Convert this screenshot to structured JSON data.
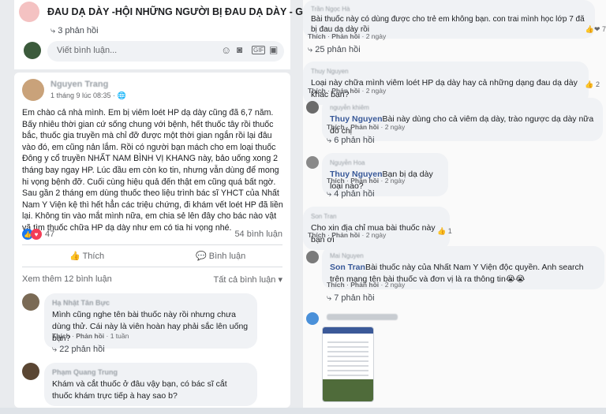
{
  "group": {
    "title": "ĐAU DẠ DÀY -HỘI NHỮNG NGƯỜI BỊ ĐAU DẠ DÀY - GIÚ..."
  },
  "left": {
    "top_reply": "3 phản hồi",
    "comment_placeholder": "Viết bình luận...",
    "post": {
      "author": "Nguyen Trang",
      "time": "1 tháng 9 lúc 08:35 ·",
      "body": "Em chào cả nhà mình. Em bị viêm loét HP dạ dày cũng đã 6,7 năm. Bấy nhiêu thời gian cứ sống chung với bệnh, hết thuốc tây rồi thuốc bắc, thuốc gia truyền mà chỉ đỡ được một thời gian ngắn rồi lại đâu vào đó, em cũng nản lắm. Rồi có người bạn mách cho em loại thuốc Đông y cổ truyền NHẤT NAM BÌNH VỊ KHANG này, bảo uống xong 2 tháng bay ngay HP. Lúc đầu em còn ko tin, nhưng vẫn dùng để mong hi vọng bệnh đỡ. Cuối cùng hiệu quả đến thật em cũng quá bất ngờ. Sau gần 2 tháng em dùng thuốc theo liệu trình bác sĩ YHCT của Nhất Nam Y Viện kệ thì hết hẳn các triệu chứng, đi khám vết loét HP đã liền lại. Không tin vào mắt mình nữa, em chia sẻ lên đây cho bác nào vật vã tìm thuốc chữa HP dạ dày như em có tia hi vọng nhé.",
      "reactions": "47",
      "comments_count": "54 bình luận",
      "like": "Thích",
      "comment": "Bình luận",
      "see_more": "Xem thêm 12 bình luận",
      "filter": "Tất cả bình luận"
    },
    "comments": [
      {
        "author": "Hạ Nhật Tân Bực",
        "text": "Mình cũng nghe tên bài thuốc này rồi nhưng chưa dùng thử. Cái này là viên hoàn hay phải sắc lên uống bạn?",
        "meta_like": "Thích",
        "meta_reply": "Phản hồi",
        "meta_time": "1 tuần",
        "replies": "22 phản hồi"
      },
      {
        "author": "Phạm Quang Trung",
        "text": "Khám và cắt thuốc ở đâu vậy bạn, có bác sĩ cắt thuốc khám trực tiếp à hay sao b?"
      }
    ]
  },
  "right": {
    "items": [
      {
        "author": "Trần Ngọc Hà",
        "text": "Bài thuốc này có dùng được cho trẻ em không bạn. con trai mình học lớp 7 đã bị đau dạ dày rồi",
        "like": "Thích",
        "reply": "Phản hồi",
        "time": "2 ngày",
        "replies": "25 phản hồi",
        "react": "7"
      },
      {
        "author": "Thuy Nguyen",
        "text": "Loại này chữa mình viêm loét HP dạ dày hay cả những dạng đau dạ dày khác bạn?",
        "like": "Thích",
        "reply": "Phản hồi",
        "time": "2 ngày",
        "react": "2"
      },
      {
        "author": "nguyễn khiêm",
        "tag": "Thuy Nguyen",
        "text": "Bài này dùng cho cả viêm dạ dày, trào ngược dạ dày nữa đó chị",
        "like": "Thích",
        "reply": "Phản hồi",
        "time": "2 ngày",
        "replies": "6 phản hồi"
      },
      {
        "author": "Nguyễn Hoa",
        "tag": "Thuy Nguyen",
        "text": "Bạn bị dạ dày loại nào?",
        "like": "Thích",
        "reply": "Phản hồi",
        "time": "2 ngày",
        "replies": "4 phản hồi"
      },
      {
        "author": "Son Tran",
        "text": "Cho xin địa chỉ mua bài thuốc này bạn ơi",
        "like": "Thích",
        "reply": "Phản hồi",
        "time": "2 ngày",
        "react": "1"
      },
      {
        "author": "Mai Nguyen",
        "tag": "Son Tran",
        "text": "Bài thuốc này của Nhất Nam Y Viện độc quyền. Anh search trên mạng tên bài thuốc và đơn vị là ra thông tin😭😭",
        "like": "Thích",
        "reply": "Phản hồi",
        "time": "2 ngày",
        "replies": "7 phản hồi"
      }
    ]
  }
}
